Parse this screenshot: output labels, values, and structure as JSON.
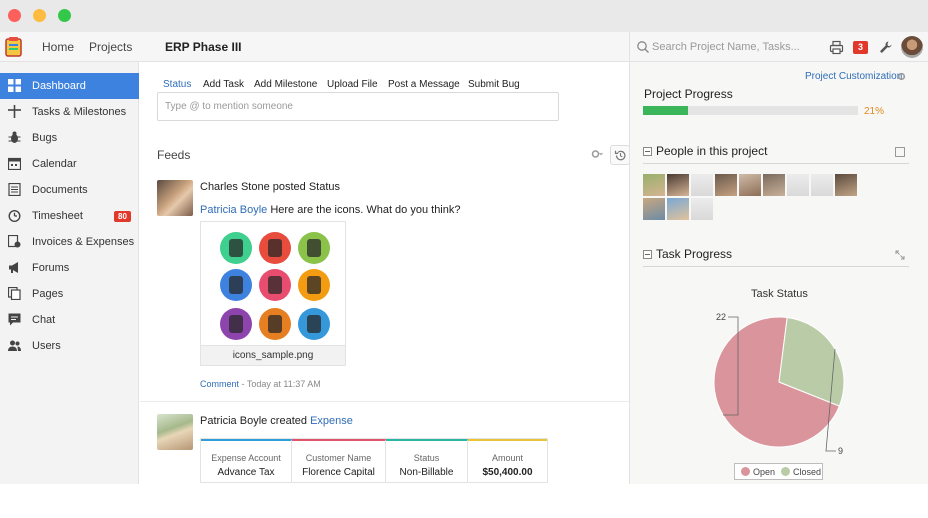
{
  "topbar": {
    "nav": [
      "Home",
      "Projects"
    ],
    "project_title": "ERP Phase III",
    "search_placeholder": "Search Project Name, Tasks...",
    "notification_count": "3"
  },
  "sidebar": {
    "items": [
      {
        "label": "Dashboard",
        "icon": "grid-icon",
        "active": true
      },
      {
        "label": "Tasks & Milestones",
        "icon": "crosshair-icon"
      },
      {
        "label": "Bugs",
        "icon": "bug-icon"
      },
      {
        "label": "Calendar",
        "icon": "calendar-icon"
      },
      {
        "label": "Documents",
        "icon": "document-icon"
      },
      {
        "label": "Timesheet",
        "icon": "clock-icon",
        "badge": "80"
      },
      {
        "label": "Invoices & Expenses",
        "icon": "invoice-icon"
      },
      {
        "label": "Forums",
        "icon": "megaphone-icon"
      },
      {
        "label": "Pages",
        "icon": "pages-icon"
      },
      {
        "label": "Chat",
        "icon": "chat-icon"
      },
      {
        "label": "Users",
        "icon": "users-icon"
      }
    ]
  },
  "main": {
    "tabs": [
      "Status",
      "Add Task",
      "Add Milestone",
      "Upload File",
      "Post a Message",
      "Submit Bug"
    ],
    "mention_placeholder": "Type @ to mention someone",
    "feeds_title": "Feeds",
    "feed1": {
      "head": "Charles Stone posted Status",
      "mention": "Patricia Boyle",
      "message": "Here are the icons. What do you think?",
      "attachment": "icons_sample.png",
      "comment": "Comment",
      "time": " - Today at 11:37 AM"
    },
    "feed2": {
      "head_prefix": "Patricia Boyle created ",
      "head_link": "Expense",
      "table": [
        {
          "header": "Expense Account",
          "value": "Advance Tax",
          "color": "#2f9ed9"
        },
        {
          "header": "Customer Name",
          "value": "Florence Capital",
          "color": "#e0536a"
        },
        {
          "header": "Status",
          "value": "Non-Billable",
          "color": "#2ab5a4"
        },
        {
          "header": "Amount",
          "value": "$50,400.00",
          "color": "#e9c33a"
        }
      ]
    }
  },
  "right": {
    "customization": "Project Customization",
    "progress_title": "Project Progress",
    "progress_percent": 21,
    "progress_label": "21%",
    "people_title": "People in this project",
    "task_title": "Task Progress"
  },
  "chart_data": {
    "type": "pie",
    "title": "Task Status",
    "categories": [
      "Open",
      "Closed"
    ],
    "values": [
      22,
      9
    ],
    "colors": [
      "#d9959b",
      "#b9cca7"
    ],
    "legend": "bottom"
  }
}
